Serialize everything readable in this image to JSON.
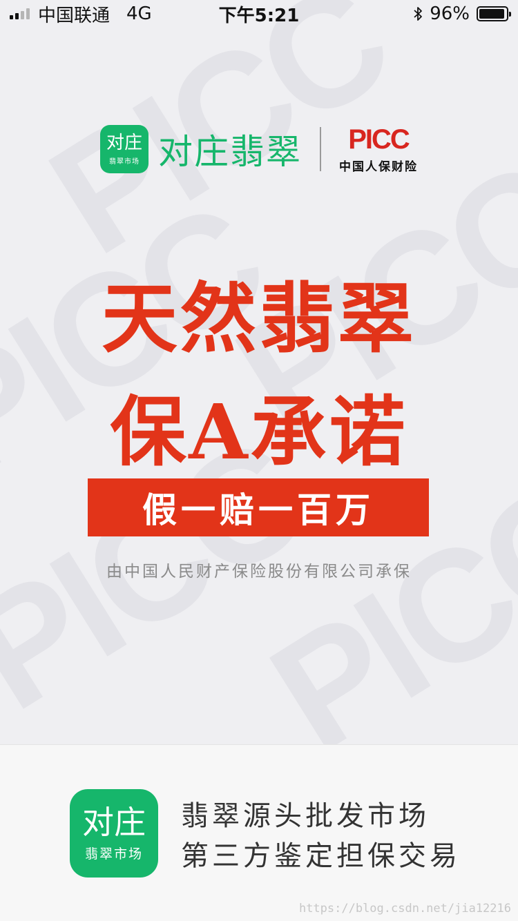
{
  "status_bar": {
    "carrier": "中国联通",
    "network": "4G",
    "time": "下午5:21",
    "battery_percent": "96%",
    "battery_level": 0.96,
    "signal_bars_active": 2,
    "signal_bars_total": 4
  },
  "header": {
    "app_icon_main": "对庄",
    "app_icon_sub": "翡翠市场",
    "brand_name": "对庄翡翠",
    "partner_logo": "PICC",
    "partner_name": "中国人保财险"
  },
  "hero": {
    "line1": "天然翡翠",
    "line2": "保A承诺",
    "promise": "假一赔一百万",
    "underwriter": "由中国人民财产保险股份有限公司承保"
  },
  "footer": {
    "icon_main": "对庄",
    "icon_sub": "翡翠市场",
    "tagline1": "翡翠源头批发市场",
    "tagline2": "第三方鉴定担保交易"
  },
  "watermark_url": "https://blog.csdn.net/jia12216",
  "background_watermark": "PICC",
  "colors": {
    "brand_green": "#16b66b",
    "headline_red": "#e23419",
    "picc_red": "#d8261f"
  }
}
